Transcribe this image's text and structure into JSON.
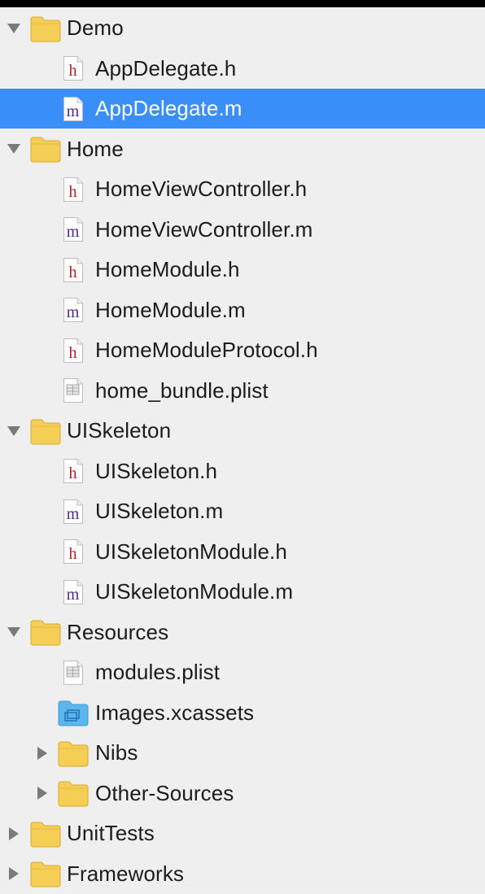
{
  "navigator": {
    "items": [
      {
        "label": "Demo",
        "type": "folder",
        "expanded": true,
        "depth": 0
      },
      {
        "label": "AppDelegate.h",
        "type": "h",
        "depth": 1
      },
      {
        "label": "AppDelegate.m",
        "type": "m",
        "depth": 1,
        "selected": true
      },
      {
        "label": "Home",
        "type": "folder",
        "expanded": true,
        "depth": 0
      },
      {
        "label": "HomeViewController.h",
        "type": "h",
        "depth": 1
      },
      {
        "label": "HomeViewController.m",
        "type": "m",
        "depth": 1
      },
      {
        "label": "HomeModule.h",
        "type": "h",
        "depth": 1
      },
      {
        "label": "HomeModule.m",
        "type": "m",
        "depth": 1
      },
      {
        "label": "HomeModuleProtocol.h",
        "type": "h",
        "depth": 1
      },
      {
        "label": "home_bundle.plist",
        "type": "plist",
        "depth": 1
      },
      {
        "label": "UISkeleton",
        "type": "folder",
        "expanded": true,
        "depth": 0
      },
      {
        "label": "UISkeleton.h",
        "type": "h",
        "depth": 1
      },
      {
        "label": "UISkeleton.m",
        "type": "m",
        "depth": 1
      },
      {
        "label": "UISkeletonModule.h",
        "type": "h",
        "depth": 1
      },
      {
        "label": "UISkeletonModule.m",
        "type": "m",
        "depth": 1
      },
      {
        "label": "Resources",
        "type": "folder",
        "expanded": true,
        "depth": 0
      },
      {
        "label": "modules.plist",
        "type": "plist",
        "depth": 1
      },
      {
        "label": "Images.xcassets",
        "type": "xcassets",
        "depth": 1
      },
      {
        "label": "Nibs",
        "type": "folder",
        "expanded": false,
        "depth": 1
      },
      {
        "label": "Other-Sources",
        "type": "folder",
        "expanded": false,
        "depth": 1
      },
      {
        "label": "UnitTests",
        "type": "folder",
        "expanded": false,
        "depth": 0
      },
      {
        "label": "Frameworks",
        "type": "folder",
        "expanded": false,
        "depth": 0
      }
    ]
  },
  "colors": {
    "selection": "#3a8ef8",
    "folder": "#f5cf55",
    "h_letter": "#b0232a",
    "m_letter": "#4a2b86",
    "xcassets": "#5bb6ee"
  }
}
